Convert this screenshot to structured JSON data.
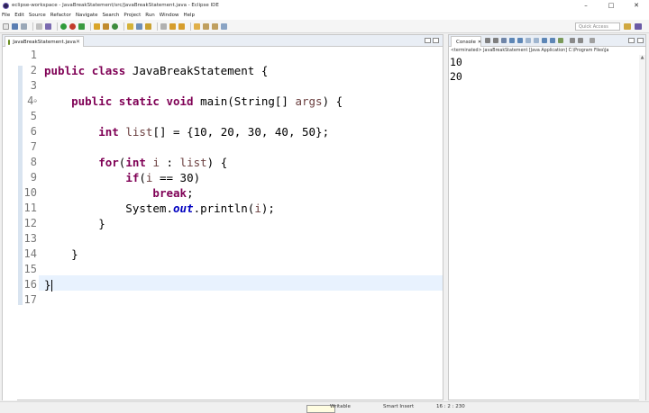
{
  "window": {
    "title": "eclipse-workspace - JavaBreakStatement/src/JavaBreakStatement.java - Eclipse IDE",
    "minimize": "–",
    "maximize": "□",
    "close": "✕"
  },
  "menu": [
    "File",
    "Edit",
    "Source",
    "Refactor",
    "Navigate",
    "Search",
    "Project",
    "Run",
    "Window",
    "Help"
  ],
  "toolbar": {
    "quick_access_placeholder": "Quick Access"
  },
  "editor": {
    "tab_label": "JavaBreakStatement.java",
    "tab_close": "✕",
    "current_line": 16,
    "line_numbers": [
      "1",
      "2",
      "3",
      "4",
      "5",
      "6",
      "7",
      "8",
      "9",
      "10",
      "11",
      "12",
      "13",
      "14",
      "15",
      "16",
      "17"
    ],
    "fold_marker": "⊖"
  },
  "console": {
    "tab_label": "Console",
    "tab_close": "✕",
    "launch_info": "<terminated> JavaBreakStatement [Java Application] C:\\Program Files\\Ja",
    "output": [
      "10",
      "20"
    ]
  },
  "status": {
    "writable": "Writable",
    "insert_mode": "Smart Insert",
    "position": "16 : 2 : 230"
  },
  "colors": {
    "keyword": "#7f0055",
    "field_static": "#0000c0",
    "variable": "#6a3e3e",
    "current_line": "#e8f2fe",
    "line_number": "#787878"
  }
}
